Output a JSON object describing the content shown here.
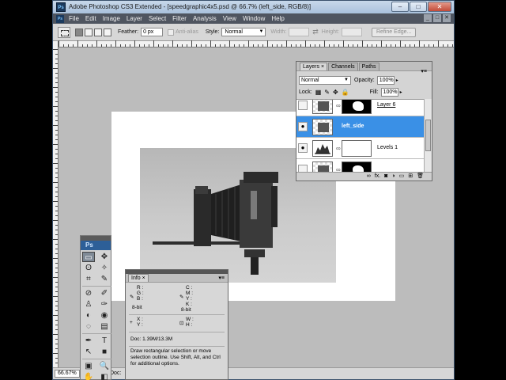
{
  "window": {
    "app_icon": "Ps",
    "title": "Adobe Photoshop CS3 Extended - [speedgraphic4x5.psd @ 66.7% (left_side, RGB/8)]",
    "controls": [
      "–",
      "□",
      "✕"
    ]
  },
  "menubar": {
    "logo": "Ps",
    "items": [
      "File",
      "Edit",
      "Image",
      "Layer",
      "Select",
      "Filter",
      "Analysis",
      "View",
      "Window",
      "Help"
    ],
    "doc_controls": [
      "_",
      "□",
      "✕"
    ]
  },
  "options": {
    "feather_label": "Feather:",
    "feather_value": "0 px",
    "antialias_label": "Anti-alias",
    "style_label": "Style:",
    "style_value": "Normal",
    "width_label": "Width:",
    "height_label": "Height:",
    "swap_icon": "⇄",
    "refine_edge": "Refine Edge..."
  },
  "status": {
    "zoom": "66.67%",
    "doc_label": "Doc:"
  },
  "tools": {
    "logo": "Ps",
    "icons": [
      "▭",
      "✥",
      "ʘ",
      "✧",
      "⌗",
      "✎",
      "⊘",
      "✐",
      "♙",
      "✑",
      "◐",
      "◉",
      "◌",
      "▤",
      "✒",
      "T",
      "↖",
      "■",
      "▣",
      "✋",
      "🔍",
      "◧"
    ]
  },
  "info": {
    "tab": "Info",
    "close": "×",
    "menu": "▾≡",
    "r": "R :",
    "g": "G :",
    "b": "B :",
    "c": "C :",
    "m": "M :",
    "y": "Y :",
    "k": "K :",
    "bit_left": "8-bit",
    "bit_right": "8-bit",
    "x": "X :",
    "yy": "Y :",
    "w": "W :",
    "h": "H :",
    "doc": "Doc: 1.39M/13.3M",
    "desc": "Draw rectangular selection or move selection outline.  Use Shift, Alt, and Ctrl for additional options."
  },
  "layers": {
    "tabs": [
      "Layers",
      "Channels",
      "Paths"
    ],
    "close": "×",
    "menu": "▾≡",
    "blend_mode": "Normal",
    "opacity_label": "Opacity:",
    "opacity": "100%",
    "lock_label": "Lock:",
    "fill_label": "Fill:",
    "fill": "100%",
    "items": [
      {
        "name": "Layer 6",
        "visible": false
      },
      {
        "name": "left_side",
        "visible": true,
        "active": true
      },
      {
        "name": "Levels 1",
        "visible": true
      },
      {
        "name": "",
        "visible": false
      }
    ],
    "footer_icons": [
      "∞",
      "fx.",
      "◙",
      "◑",
      "▭",
      "⊞",
      "🗑"
    ]
  },
  "colors": {
    "accent_selected": "#3a90e6",
    "menubar": "#4f5560",
    "titlebar": "#b3c9e1",
    "workspace": "#bcbcbc"
  }
}
